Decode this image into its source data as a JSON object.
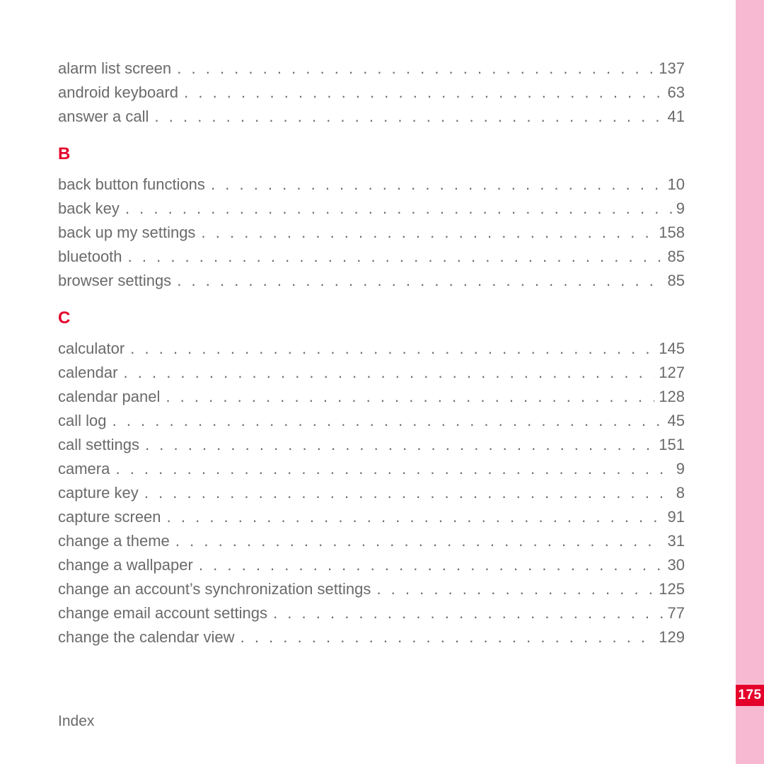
{
  "footer_label": "Index",
  "page_number": "175",
  "sections": [
    {
      "heading": "",
      "entries": [
        {
          "label": "alarm list screen",
          "page": "137"
        },
        {
          "label": "android keyboard",
          "page": "63"
        },
        {
          "label": "answer a call",
          "page": "41"
        }
      ]
    },
    {
      "heading": "B",
      "entries": [
        {
          "label": "back button functions",
          "page": "10"
        },
        {
          "label": "back key",
          "page": "9"
        },
        {
          "label": "back up my settings",
          "page": "158"
        },
        {
          "label": "bluetooth",
          "page": "85"
        },
        {
          "label": "browser settings",
          "page": "85"
        }
      ]
    },
    {
      "heading": "C",
      "entries": [
        {
          "label": "calculator",
          "page": "145"
        },
        {
          "label": "calendar",
          "page": "127"
        },
        {
          "label": "calendar panel",
          "page": "128"
        },
        {
          "label": "call log",
          "page": "45"
        },
        {
          "label": "call settings",
          "page": "151"
        },
        {
          "label": "camera",
          "page": "9"
        },
        {
          "label": "capture key",
          "page": "8"
        },
        {
          "label": "capture screen",
          "page": "91"
        },
        {
          "label": "change a theme",
          "page": "31"
        },
        {
          "label": "change a wallpaper",
          "page": "30"
        },
        {
          "label": "change an account’s synchronization settings",
          "page": "125"
        },
        {
          "label": "change email account settings",
          "page": "77"
        },
        {
          "label": "change the calendar view",
          "page": "129"
        }
      ]
    }
  ]
}
